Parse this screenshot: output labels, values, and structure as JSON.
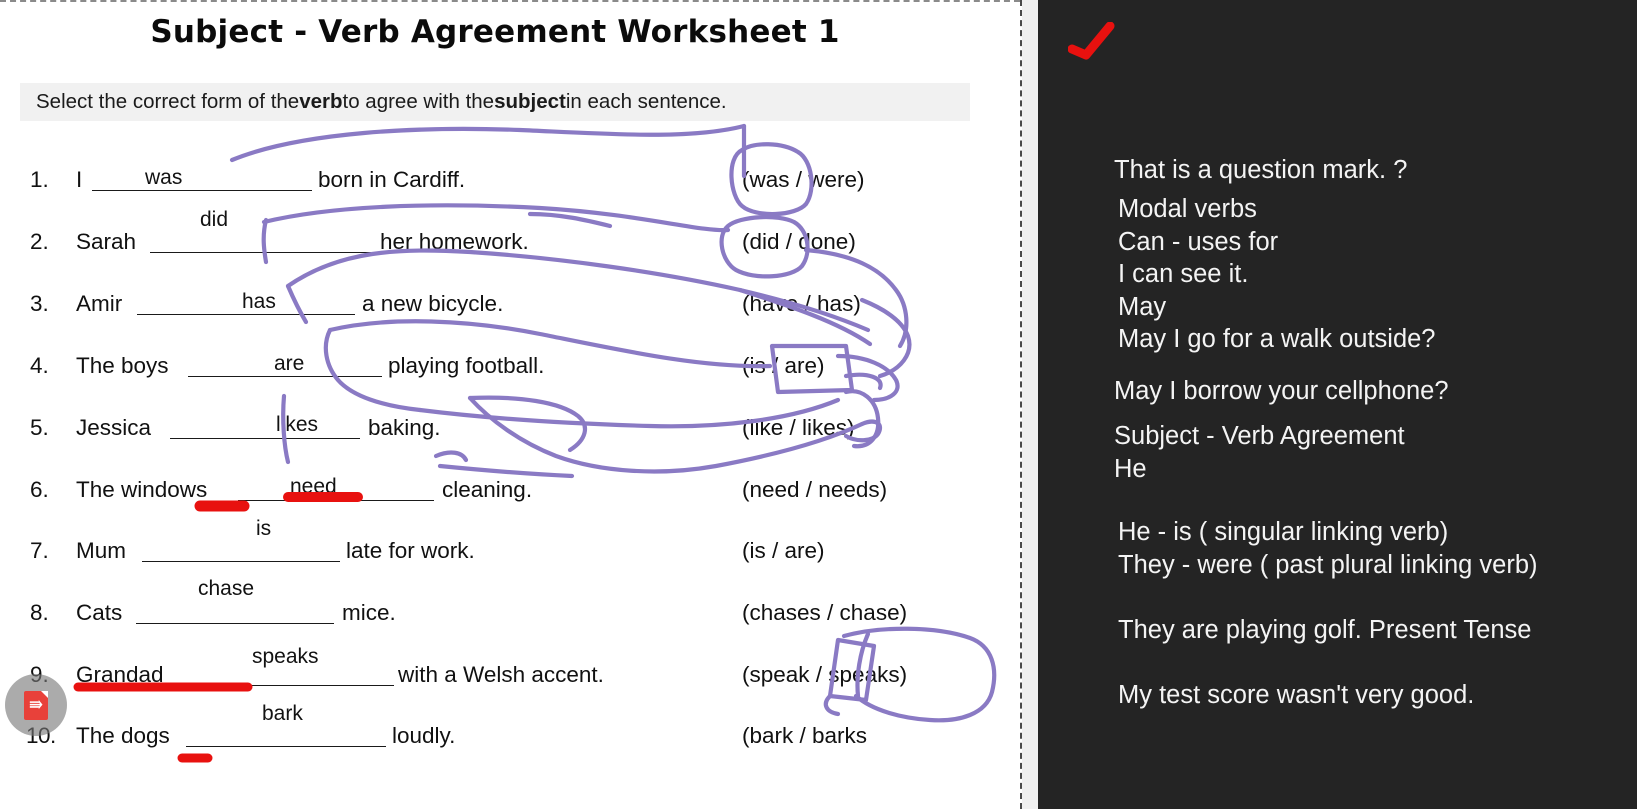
{
  "worksheet": {
    "title": "Subject - Verb Agreement Worksheet 1",
    "instruction_parts": {
      "p1": "Select the correct form of the ",
      "b1": "verb",
      "p2": " to agree with the ",
      "b2": "subject",
      "p3": " in each sentence."
    },
    "questions": [
      {
        "num": "1.",
        "pre": "I",
        "answer": "was",
        "post": "born in Cardiff.",
        "options": "(was / were)"
      },
      {
        "num": "2.",
        "pre": "Sarah",
        "answer": "did",
        "post": "her homework.",
        "options": "(did / done)"
      },
      {
        "num": "3.",
        "pre": "Amir",
        "answer": "has",
        "post": "a new bicycle.",
        "options": "(have / has)"
      },
      {
        "num": "4.",
        "pre": "The boys",
        "answer": "are",
        "post": "playing football.",
        "options": "(is / are)"
      },
      {
        "num": "5.",
        "pre": "Jessica",
        "answer": "likes",
        "post": "baking.",
        "options": "(like / likes)"
      },
      {
        "num": "6.",
        "pre": "The windows",
        "answer": "need",
        "post": "cleaning.",
        "options": "(need / needs)"
      },
      {
        "num": "7.",
        "pre": "Mum",
        "answer": "is",
        "post": "late for work.",
        "options": "(is / are)"
      },
      {
        "num": "8.",
        "pre": "Cats",
        "answer": "chase",
        "post": "mice.",
        "options": "(chases / chase)"
      },
      {
        "num": "9.",
        "pre": "Grandad",
        "answer": "speaks",
        "post": "with a Welsh accent.",
        "options": "(speak / speaks)"
      },
      {
        "num": "10.",
        "pre": "The dogs",
        "answer": "bark",
        "post": "loudly.",
        "options": "(bark / barks"
      }
    ]
  },
  "pdf_button": {
    "label": "PDF"
  },
  "notes": {
    "lines": [
      "That is a question mark.   ?",
      "Modal verbs",
      "Can - uses for",
      "I can see it.",
      "May",
      "May I go for a walk outside?",
      "May I borrow your cellphone?",
      "Subject - Verb Agreement",
      "He",
      "He -    is ( singular linking verb)",
      "They -  were ( past plural linking verb)",
      "They are playing golf.   Present Tense",
      "My test score wasn't very good."
    ]
  },
  "colors": {
    "panel_bg": "#242424",
    "ink_purple": "#8a7ac4",
    "ink_red": "#e8110f",
    "doc_bg": "#ffffff",
    "instruction_bg": "#f1f1f1"
  }
}
